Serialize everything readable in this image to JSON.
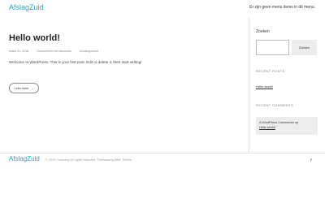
{
  "header": {
    "site_title": "AfslagZuid",
    "menu_text": "Er zijn geen menu items in dit menu."
  },
  "post": {
    "title": "Hello world!",
    "meta": {
      "date": "maart 31, 2018",
      "author": "Geschreven met favowebs",
      "category": "Uncategorized"
    },
    "excerpt": "Welcome to WordPress. This is your first post. Edit or delete it, then start writing!",
    "read_more_label": "Lees meer",
    "read_more_icon": "arrow-right-icon"
  },
  "sidebar": {
    "search_label": "Zoeken",
    "search_value": "",
    "search_button_label": "Zoeken",
    "recent_posts_title": "RECENT POSTS",
    "recent_posts": [
      {
        "label": "Hello world!"
      }
    ],
    "recent_comments_title": "RECENT COMMENTS",
    "recent_comment": {
      "author": "A WordPress Commenter",
      "connector": "op",
      "post": "Hello world!"
    }
  },
  "footer": {
    "site_title": "AfslagZuid",
    "copyright": "© 2019 Company All rights reserved. Theewaterig Affibl Theme.",
    "social_icon": "facebook-icon"
  },
  "colors": {
    "brand": "#1fa8c9",
    "comment_bg": "#ececec",
    "border": "#e2e2e2"
  }
}
